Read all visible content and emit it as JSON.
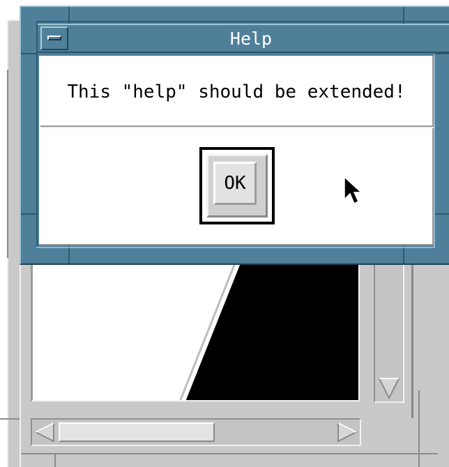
{
  "dialog": {
    "title": "Help",
    "message": "This \"help\" should be extended!",
    "ok_label": "OK",
    "window_menu_icon": "window-menu-icon"
  },
  "background_window": {
    "vertical_scrollbar": {
      "arrow_icon": "triangle-down-icon"
    },
    "horizontal_scrollbar": {
      "left_arrow_icon": "triangle-left-icon",
      "right_arrow_icon": "triangle-right-icon"
    }
  },
  "cursor": {
    "icon": "mouse-pointer-icon"
  },
  "colors": {
    "title_bar": "#4f7f99",
    "frame_bg": "#c9c9c9",
    "canvas_fill": "#000000"
  }
}
